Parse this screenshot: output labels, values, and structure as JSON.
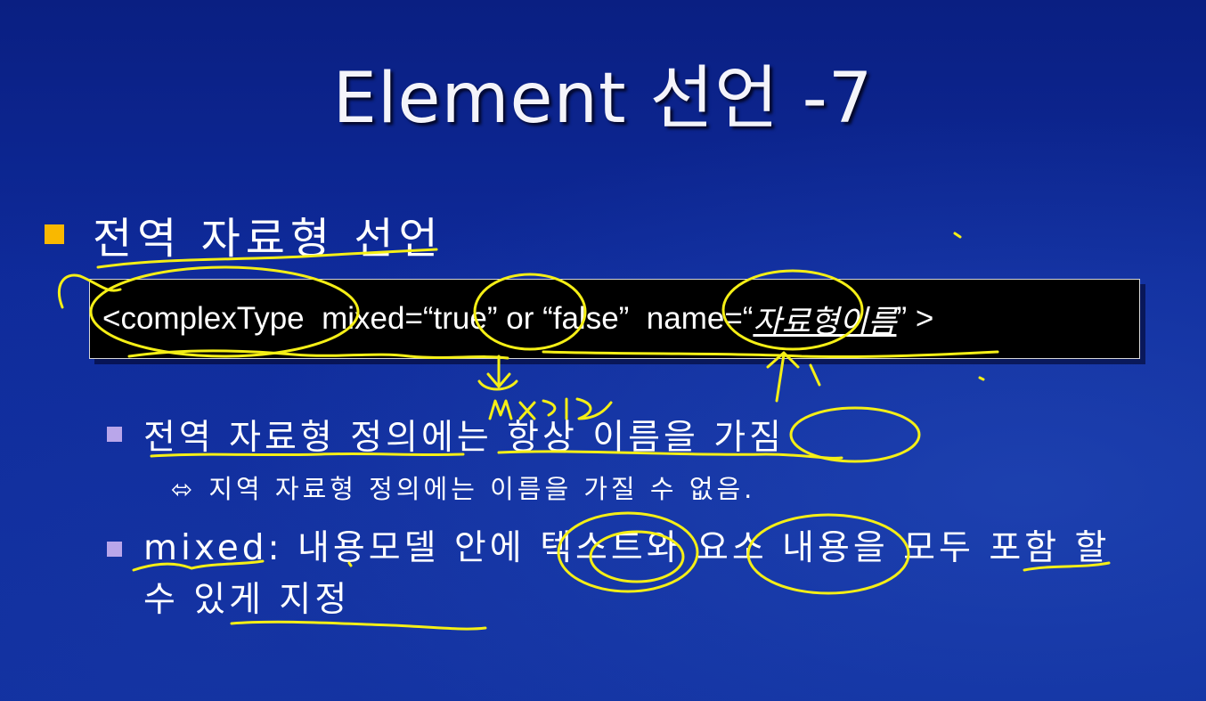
{
  "slide": {
    "title": "Element 선언 -7",
    "heading": "전역 자료형 선언",
    "code": {
      "prefix": "<complexType  mixed=“true” or “false”  name=“",
      "placeholder": "자료형이름",
      "suffix": "” >"
    },
    "bullet1": "전역 자료형 정의에는 항상 이름을 가짐",
    "note": {
      "arrow": "⬄",
      "text": "지역 자료형 정의에는 이름을 가질 수 없음."
    },
    "bullet2": "mixed: 내용모델 안에 텍스트와 요소 내용을 모두 포함 할 수 있게 지정"
  },
  "colors": {
    "background": "#0e2a9a",
    "bullet_l1": "#f9b800",
    "bullet_l2": "#b9a6ea",
    "annotation_ink": "#f5ef16"
  }
}
